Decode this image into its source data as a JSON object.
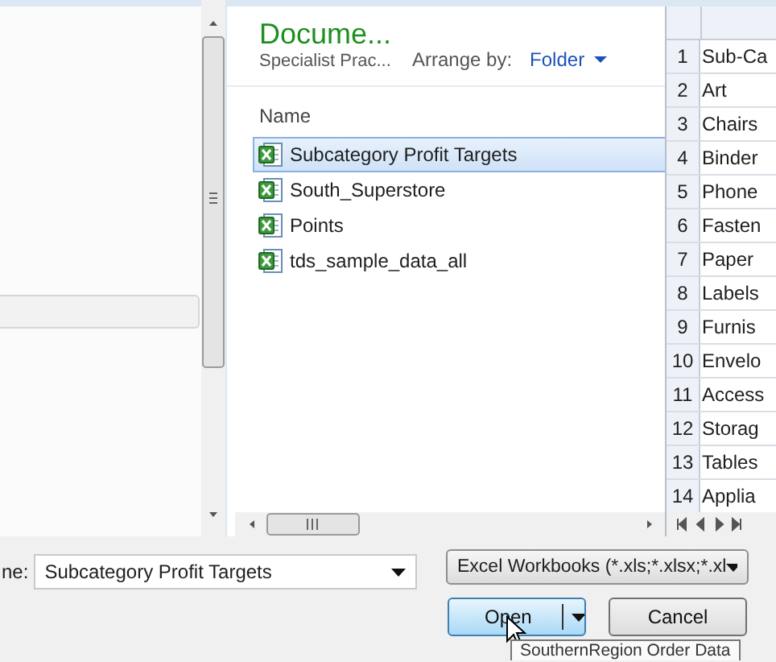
{
  "library": {
    "title": "Docume...",
    "subtitle": "Specialist Prac...",
    "arrange_label": "Arrange by:",
    "arrange_value": "Folder"
  },
  "file_list": {
    "column": "Name",
    "files": [
      {
        "name": "Subcategory Profit Targets",
        "selected": true
      },
      {
        "name": "South_Superstore",
        "selected": false
      },
      {
        "name": "Points",
        "selected": false
      },
      {
        "name": "tds_sample_data_all",
        "selected": false
      }
    ]
  },
  "preview": {
    "rows": [
      {
        "number": "1",
        "cell": "Sub-Ca"
      },
      {
        "number": "2",
        "cell": "Art"
      },
      {
        "number": "3",
        "cell": "Chairs"
      },
      {
        "number": "4",
        "cell": "Binder"
      },
      {
        "number": "5",
        "cell": "Phone"
      },
      {
        "number": "6",
        "cell": "Fasten"
      },
      {
        "number": "7",
        "cell": "Paper"
      },
      {
        "number": "8",
        "cell": "Labels"
      },
      {
        "number": "9",
        "cell": "Furnis"
      },
      {
        "number": "10",
        "cell": "Envelo"
      },
      {
        "number": "11",
        "cell": "Access"
      },
      {
        "number": "12",
        "cell": "Storag"
      },
      {
        "number": "13",
        "cell": "Tables"
      },
      {
        "number": "14",
        "cell": "Applia"
      }
    ]
  },
  "file_name": {
    "label": "ne:",
    "value": "Subcategory Profit Targets"
  },
  "file_type": "Excel Workbooks (*.xls;*.xlsx;*.xl",
  "buttons": [
    {
      "label": "Open",
      "kind": "split"
    },
    {
      "label": "Cancel",
      "kind": "plain"
    }
  ],
  "tooltip": "SouthernRegion Order Data"
}
